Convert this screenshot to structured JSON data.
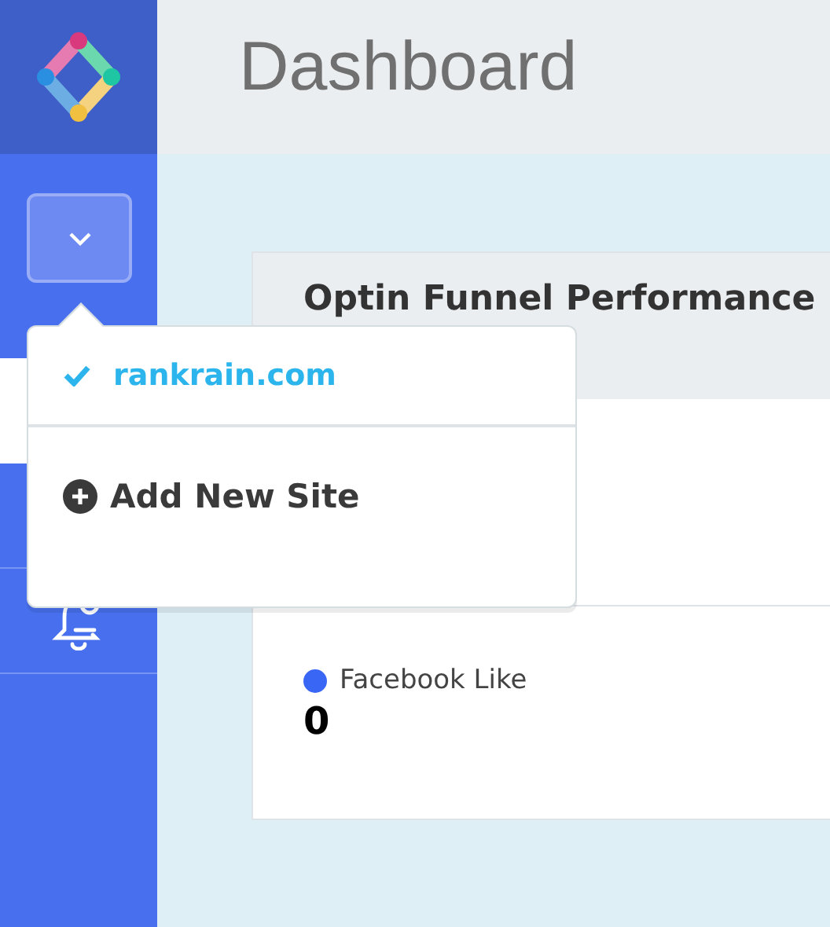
{
  "header": {
    "title": "Dashboard"
  },
  "sidebar": {
    "nav_items": [
      {
        "kind": "blank",
        "selected": true
      },
      {
        "kind": "blank",
        "selected": false
      },
      {
        "kind": "bell",
        "selected": false
      }
    ]
  },
  "site_menu": {
    "expanded": true,
    "sites": [
      {
        "label": "rankrain.com",
        "selected": true
      }
    ],
    "add_label": "Add New Site"
  },
  "card": {
    "title": "Optin Funnel Performance",
    "legend": [
      {
        "label": "Facebook Like",
        "color": "#3a66f5",
        "value": "0"
      }
    ]
  }
}
